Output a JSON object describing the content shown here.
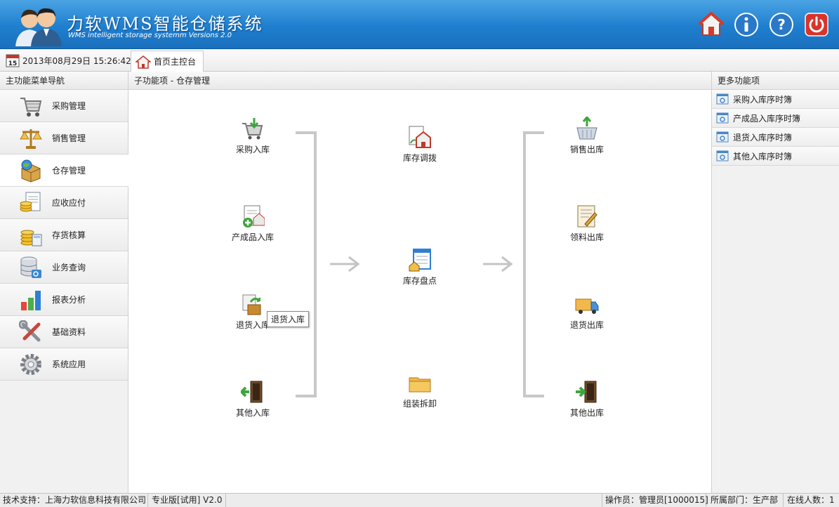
{
  "header": {
    "title": "力软WMS智能仓储系统",
    "subtitle": "WMS intelligent storage systemm Versions 2.0",
    "buttons": [
      {
        "name": "home-icon"
      },
      {
        "name": "info-icon"
      },
      {
        "name": "help-icon"
      },
      {
        "name": "power-icon"
      }
    ]
  },
  "toolbar": {
    "calendar_day": "15",
    "datetime": "2013年08月29日 15:26:42",
    "tab_label": "首页主控台"
  },
  "left": {
    "heading": "主功能菜单导航",
    "items": [
      {
        "label": "采购管理",
        "icon": "shopping-cart-icon"
      },
      {
        "label": "销售管理",
        "icon": "scales-icon"
      },
      {
        "label": "仓存管理",
        "icon": "package-globe-icon",
        "active": true
      },
      {
        "label": "应收应付",
        "icon": "document-coins-icon"
      },
      {
        "label": "存货核算",
        "icon": "coins-calculator-icon"
      },
      {
        "label": "业务查询",
        "icon": "database-search-icon"
      },
      {
        "label": "报表分析",
        "icon": "bar-chart-icon"
      },
      {
        "label": "基础资料",
        "icon": "tools-icon"
      },
      {
        "label": "系统应用",
        "icon": "gear-icon"
      }
    ]
  },
  "center": {
    "heading": "子功能项 - 仓存管理",
    "inbound": [
      "采购入库",
      "产成品入库",
      "退货入库",
      "其他入库"
    ],
    "middle": [
      "库存调拨",
      "库存盘点",
      "组装拆卸"
    ],
    "outbound": [
      "销售出库",
      "领料出库",
      "退货出库",
      "其他出库"
    ],
    "tooltip": "退货入库"
  },
  "right": {
    "heading": "更多功能项",
    "items": [
      "采购入库序时簿",
      "产成品入库序时簿",
      "退货入库序时簿",
      "其他入库序时簿"
    ]
  },
  "status": {
    "support": "技术支持：上海力软信息科技有限公司",
    "edition": "专业版[试用] V2.0",
    "operator": "操作员：管理员[1000015]",
    "department": "所属部门：生产部",
    "online": "在线人数：1"
  },
  "colors": {
    "header_blue": "#1f7fcf",
    "bracket_gray": "#c8c8c8"
  }
}
